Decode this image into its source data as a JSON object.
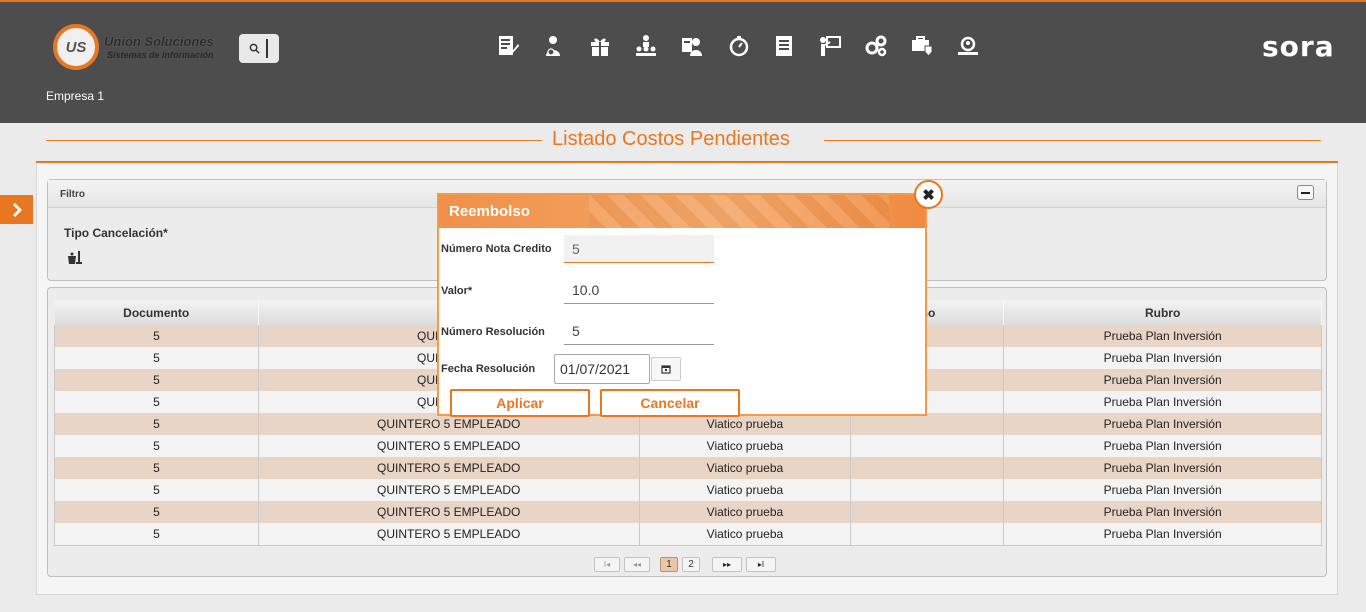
{
  "header": {
    "logo_title": "Unión Soluciones",
    "logo_subtitle": "Sistemas de Información",
    "logo_mark": "US",
    "brand": "sora",
    "company": "Empresa 1",
    "nav_icons": [
      "edit-document-icon",
      "user-money-icon",
      "gift-icon",
      "hierarchy-icon",
      "user-card-icon",
      "stopwatch-icon",
      "report-list-icon",
      "presentation-icon",
      "gears-icon",
      "briefcase-shield-icon",
      "people-search-icon"
    ],
    "accent": "#e87722"
  },
  "page": {
    "title": "Listado Costos Pendientes"
  },
  "filter": {
    "heading": "Filtro",
    "label": "Tipo Cancelación*"
  },
  "table": {
    "columns": [
      "Documento",
      "Em",
      "",
      "tino",
      "Rubro"
    ],
    "rows": [
      [
        "5",
        "QUINTERO",
        "",
        "",
        "Prueba Plan Inversión"
      ],
      [
        "5",
        "QUINTERO",
        "",
        "",
        "Prueba Plan Inversión"
      ],
      [
        "5",
        "QUINTERO",
        "",
        "",
        "Prueba Plan Inversión"
      ],
      [
        "5",
        "QUINTERO",
        "",
        "",
        "Prueba Plan Inversión"
      ],
      [
        "5",
        "QUINTERO 5 EMPLEADO",
        "Viatico prueba",
        "",
        "Prueba Plan Inversión"
      ],
      [
        "5",
        "QUINTERO 5 EMPLEADO",
        "Viatico prueba",
        "",
        "Prueba Plan Inversión"
      ],
      [
        "5",
        "QUINTERO 5 EMPLEADO",
        "Viatico prueba",
        "",
        "Prueba Plan Inversión"
      ],
      [
        "5",
        "QUINTERO 5 EMPLEADO",
        "Viatico prueba",
        "",
        "Prueba Plan Inversión"
      ],
      [
        "5",
        "QUINTERO 5 EMPLEADO",
        "Viatico prueba",
        "",
        "Prueba Plan Inversión"
      ],
      [
        "5",
        "QUINTERO 5 EMPLEADO",
        "Viatico prueba",
        "",
        "Prueba Plan Inversión"
      ]
    ]
  },
  "pager": {
    "first": "I◂",
    "prev": "◂◂",
    "pages": [
      "1",
      "2"
    ],
    "current": "1",
    "next": "▸▸",
    "last": "▸I"
  },
  "modal": {
    "title": "Reembolso",
    "close": "✖",
    "fields": {
      "nota_label": "Número Nota Credito",
      "nota_value": "5",
      "valor_label": "Valor*",
      "valor_value": "10.0",
      "resolucion_label": "Número Resolución",
      "resolucion_value": "5",
      "fecha_label": "Fecha Resolución",
      "fecha_value": "01/07/2021"
    },
    "apply": "Aplicar",
    "cancel": "Cancelar"
  }
}
